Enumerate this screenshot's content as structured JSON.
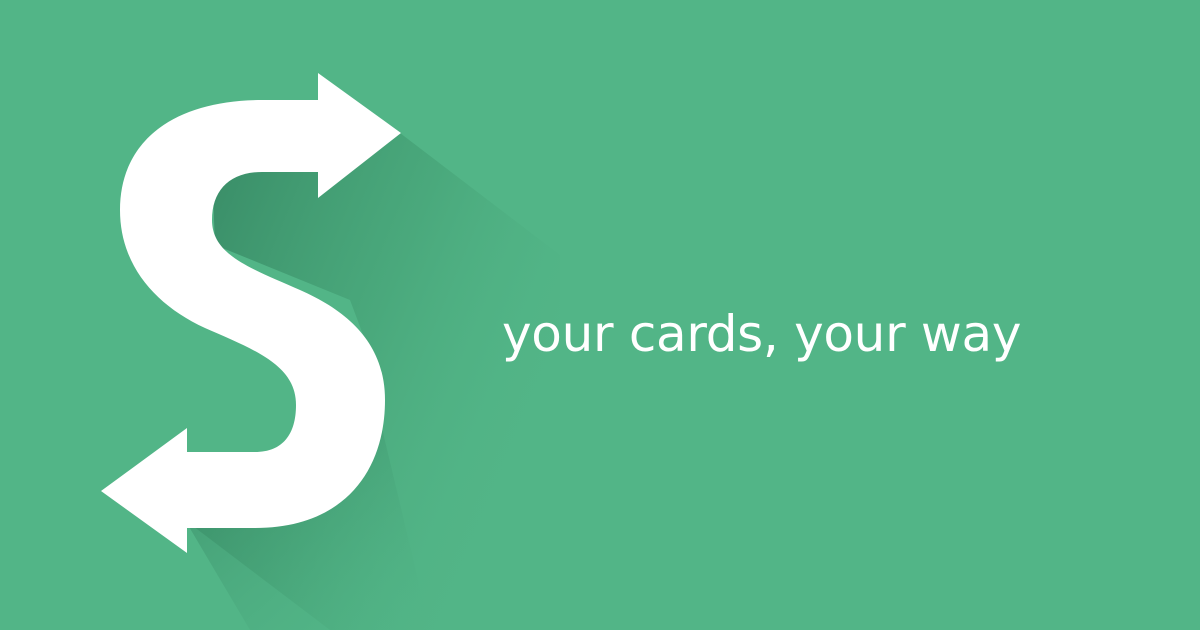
{
  "banner": {
    "tagline": "your cards, your way"
  },
  "logo": {
    "icon": "s-double-arrow-icon"
  },
  "colors": {
    "background": "#52b587",
    "logo": "#ffffff",
    "shadow": "#2e7a59",
    "text": "#ffffff"
  }
}
